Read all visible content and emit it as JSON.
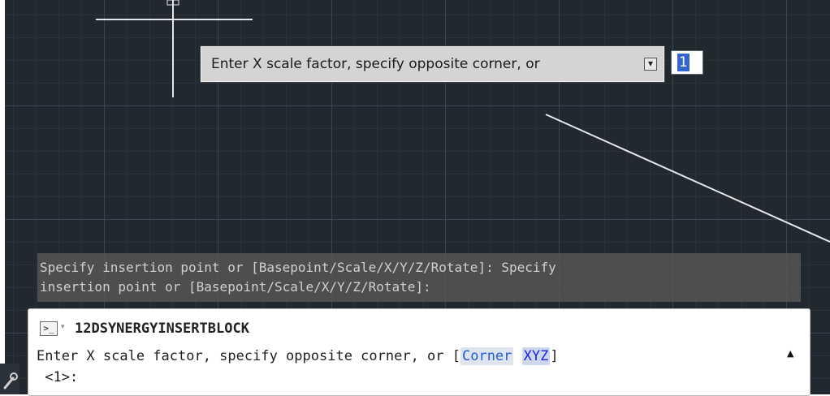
{
  "tooltip": {
    "label": "Enter X scale factor, specify opposite corner, or",
    "options_glyph": "▾",
    "input_value": "1"
  },
  "history": {
    "line1": "Specify insertion point or [Basepoint/Scale/X/Y/Z/Rotate]: Specify",
    "line2": "insertion point or [Basepoint/Scale/X/Y/Z/Rotate]:"
  },
  "command_line": {
    "prompt_icon_text": ">_",
    "dropdown_glyph": "▾",
    "command_name": "12DSYNERGYINSERTBLOCK",
    "prompt_text": "Enter X scale factor, specify opposite corner, or [",
    "option_corner": "Corner",
    "option_xyz": "XYZ",
    "prompt_close": "]",
    "default_value": " <1>:",
    "scroll_glyph": "▲"
  },
  "colors": {
    "canvas_background": "#212830",
    "grid_major": "#3b4450",
    "grid_minor": "#2a313a",
    "option_corner": "#1f5ad6",
    "option_xyz": "#1a22e0",
    "input_highlight": "#3366cc"
  },
  "icons": [
    "crosshair-cursor-icon",
    "tooltip-options-icon",
    "command-prompt-icon",
    "scroll-up-icon",
    "wrench-icon"
  ]
}
